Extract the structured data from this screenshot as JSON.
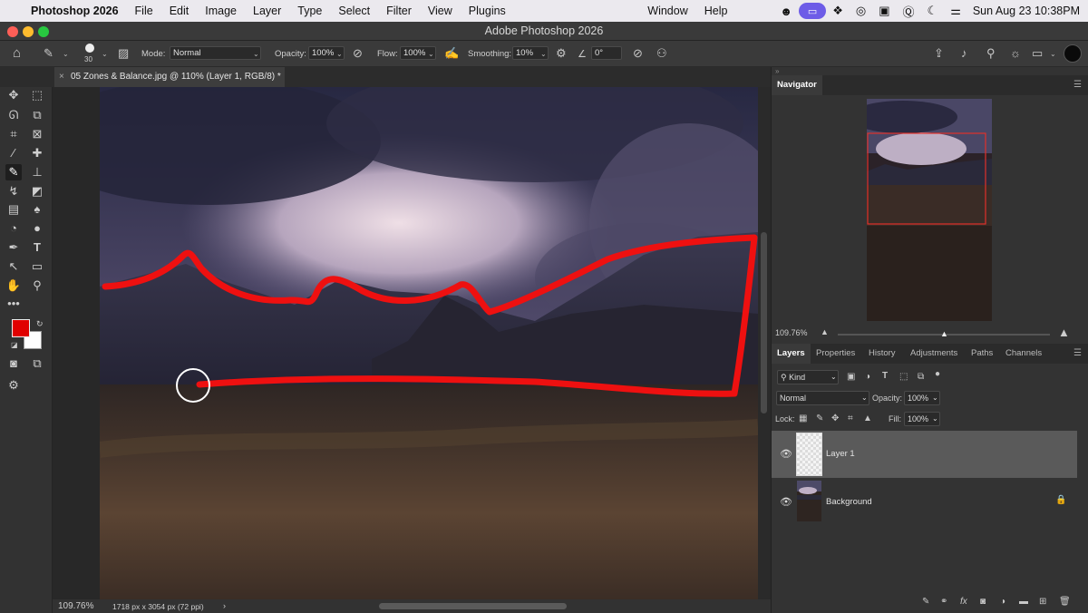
{
  "menubar": {
    "app_name": "Photoshop 2026",
    "menus": [
      "File",
      "Edit",
      "Image",
      "Layer",
      "Type",
      "Select",
      "Filter",
      "View",
      "Plugins"
    ],
    "right_menus": [
      "Window",
      "Help"
    ],
    "clock": "Sun Aug 23  10:38PM"
  },
  "window": {
    "title": "Adobe Photoshop 2026"
  },
  "options": {
    "brush_size": "30",
    "mode_label": "Mode:",
    "mode_value": "Normal",
    "opacity_label": "Opacity:",
    "opacity_value": "100%",
    "flow_label": "Flow:",
    "flow_value": "100%",
    "smoothing_label": "Smoothing:",
    "smoothing_value": "10%",
    "angle_value": "0°"
  },
  "document": {
    "tab_title": "05 Zones & Balance.jpg @ 110% (Layer 1, RGB/8) *",
    "zoom": "109.76%",
    "dimensions": "1718 px x 3054 px (72 ppi)"
  },
  "colors": {
    "foreground": "#e00000",
    "background": "#ffffff",
    "stroke": "#ee1010"
  },
  "navigator": {
    "tab": "Navigator",
    "zoom": "109.76%"
  },
  "layers_panel": {
    "tabs": [
      "Layers",
      "Properties",
      "History",
      "Adjustments",
      "Paths",
      "Channels"
    ],
    "filter_kind": "Kind",
    "blend_mode": "Normal",
    "opacity_label": "Opacity:",
    "opacity_value": "100%",
    "lock_label": "Lock:",
    "fill_label": "Fill:",
    "fill_value": "100%",
    "layers": [
      {
        "name": "Layer 1",
        "selected": true,
        "visible": true
      },
      {
        "name": "Background",
        "selected": false,
        "visible": true,
        "locked": true
      }
    ]
  }
}
